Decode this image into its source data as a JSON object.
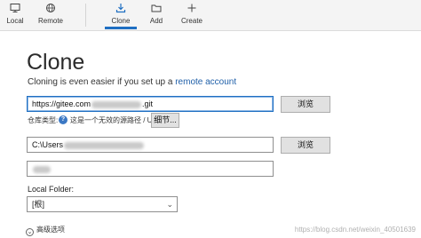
{
  "toolbar": {
    "items": [
      {
        "label": "Local",
        "icon": "monitor-icon",
        "active": false
      },
      {
        "label": "Remote",
        "icon": "globe-icon",
        "active": false
      },
      {
        "label": "Clone",
        "icon": "download-icon",
        "active": true
      },
      {
        "label": "Add",
        "icon": "folder-icon",
        "active": false
      },
      {
        "label": "Create",
        "icon": "plus-icon",
        "active": false
      }
    ],
    "accent_color": "#1f6fc2"
  },
  "main": {
    "title": "Clone",
    "subtitle_prefix": "Cloning is even easier if you set up a",
    "subtitle_link": "remote account",
    "source_url": {
      "value_start": "https://gitee.com",
      "value_end": ".git",
      "browse_label": "浏览"
    },
    "repo_type": {
      "label": "仓库类型:",
      "hint": "这是一个无效的源路径 / URL",
      "details_label": "细节..."
    },
    "destination": {
      "value": "C:\\Users",
      "browse_label": "浏览"
    },
    "name_field": {
      "value": ""
    },
    "local_folder": {
      "label": "Local Folder:",
      "selected": "[根]"
    },
    "advanced": {
      "label": "高级选项"
    }
  },
  "watermark": {
    "text": "https://blog.csdn.net/weixin_40501639"
  }
}
